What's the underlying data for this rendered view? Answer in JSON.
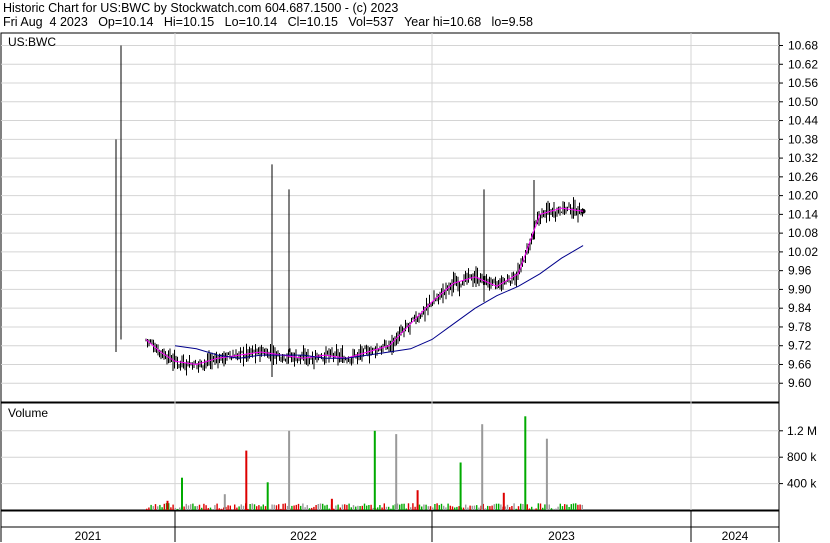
{
  "header": {
    "line1": "Historic Chart for US:BWC by Stockwatch.com 604.687.1500 - (c) 2023",
    "line2": "Fri Aug  4 2023   Op=10.14   Hi=10.15   Lo=10.14   Cl=10.15   Vol=537   Year hi=10.68   lo=9.58"
  },
  "chart_data": [
    {
      "type": "line",
      "title": "US:BWC",
      "ylim": [
        9.54,
        10.72
      ],
      "yticks": [
        "10.68",
        "10.62",
        "10.56",
        "10.50",
        "10.44",
        "10.38",
        "10.32",
        "10.26",
        "10.20",
        "10.14",
        "10.08",
        "10.02",
        "9.96",
        "9.90",
        "9.84",
        "9.78",
        "9.72",
        "9.66",
        "9.60"
      ],
      "xticks": [
        "2021",
        "2022",
        "2023",
        "2024"
      ],
      "x": [
        "2021-11",
        "2021-12",
        "2022-01",
        "2022-02",
        "2022-03",
        "2022-04",
        "2022-05",
        "2022-06",
        "2022-07",
        "2022-08",
        "2022-09",
        "2022-10",
        "2022-11",
        "2022-12",
        "2023-01",
        "2023-02",
        "2023-03",
        "2023-04",
        "2023-05",
        "2023-06",
        "2023-07",
        "2023-08"
      ],
      "series": [
        {
          "values": [
            9.74,
            9.7,
            9.67,
            9.66,
            9.68,
            9.69,
            9.7,
            9.69,
            9.68,
            9.69,
            9.68,
            9.7,
            9.72,
            9.79,
            9.86,
            9.92,
            9.94,
            9.91,
            9.95,
            10.14,
            10.16,
            10.15
          ]
        },
        {
          "values": [
            null,
            null,
            9.72,
            9.71,
            9.69,
            9.68,
            9.69,
            9.69,
            9.69,
            9.68,
            9.68,
            9.69,
            9.7,
            9.71,
            9.74,
            9.79,
            9.84,
            9.88,
            9.91,
            9.95,
            10.0,
            10.04
          ]
        }
      ],
      "colors": {
        "price": "#000000",
        "ma_short": "#ff00ff",
        "ma_long": "#00008b",
        "up_volume": "#00aa00",
        "down_volume": "#dd0000",
        "flat_volume": "#999999"
      }
    },
    {
      "type": "bar",
      "title": "Volume",
      "yticks": [
        "1.2 M",
        "800 k",
        "400 k"
      ],
      "ylim": [
        0,
        1500000
      ],
      "x": [
        "2021-12",
        "2022-01",
        "2022-03",
        "2022-04",
        "2022-05",
        "2022-06",
        "2022-08",
        "2022-10",
        "2022-11",
        "2022-12",
        "2023-02",
        "2023-03",
        "2023-04",
        "2023-05",
        "2023-06"
      ],
      "values": [
        140000,
        490000,
        240000,
        900000,
        420000,
        1200000,
        170000,
        1200000,
        1150000,
        300000,
        720000,
        1300000,
        260000,
        1420000,
        1080000
      ]
    }
  ]
}
